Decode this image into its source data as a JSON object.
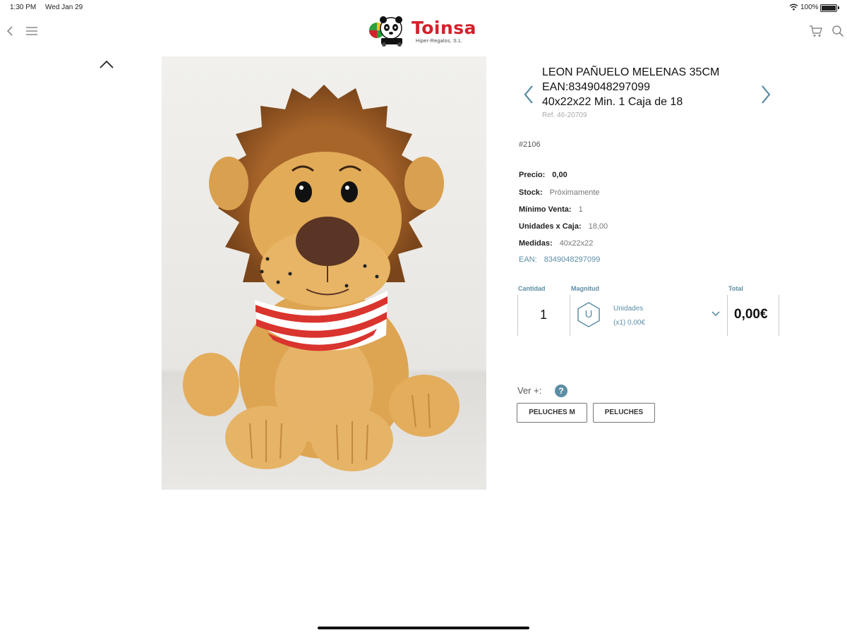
{
  "status_bar": {
    "time": "1:30 PM",
    "date": "Wed Jan 29",
    "battery": "100%"
  },
  "brand": {
    "name": "Toinsa",
    "subtitle": "Hiper-Regalos, S.L.",
    "color": "#d3212c"
  },
  "header_icons": [
    "back-icon",
    "menu-icon",
    "cart-icon",
    "search-icon"
  ],
  "gallery": {
    "collapse_icon": "chevron-up-icon"
  },
  "product": {
    "title_lines": [
      "LEON PAÑUELO MELENAS 35CM",
      "EAN:8349048297099",
      "40x22x22 Min. 1 Caja de 18"
    ],
    "ref": "Ref. 46-20709",
    "code": "#2106",
    "specs": [
      {
        "key": "Precio:",
        "value": "0,00"
      },
      {
        "key": "Stock:",
        "value": "Próximamente"
      },
      {
        "key": "Mínimo Venta:",
        "value": "1"
      },
      {
        "key": "Unidades x Caja:",
        "value": "18,00"
      },
      {
        "key": "Medidas:",
        "value": "40x22x22"
      },
      {
        "key": "EAN:",
        "value": "8349048297099"
      }
    ]
  },
  "order": {
    "quantity_label": "Cantidad",
    "quantity_value": "1",
    "magnitude_label": "Magnitud",
    "magnitude_symbol": "U",
    "magnitude_name": "Unidades",
    "magnitude_detail": "(x1)  0,00€",
    "total_label": "Total",
    "total_value": "0,00€"
  },
  "related": {
    "label": "Ver +:",
    "help": "?",
    "tags": [
      "PELUCHES M",
      "PELUCHES"
    ]
  },
  "accent_color": "#5c8ea6"
}
